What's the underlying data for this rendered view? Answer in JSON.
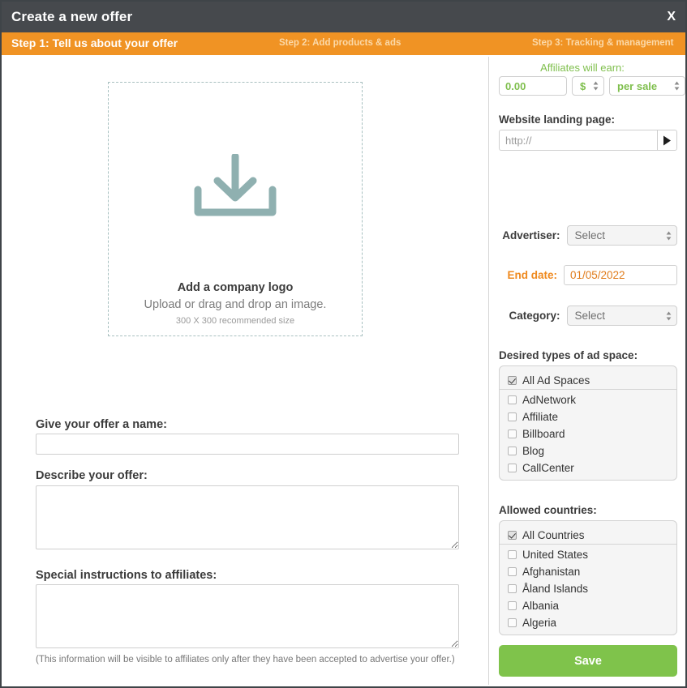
{
  "titlebar": {
    "title": "Create a new offer",
    "close_label": "X"
  },
  "steps": {
    "step1_prefix": "Step 1:",
    "step1": "Step 1: Tell us about your offer",
    "step2": "Step 2: Add products & ads",
    "step3": "Step 3: Tracking & management"
  },
  "left": {
    "dropzone": {
      "title": "Add a company logo",
      "subtitle": "Upload or drag and drop an image.",
      "hint": "300 X 300 recommended size",
      "icon": "download-arrow-icon"
    },
    "offer_name": {
      "label": "Give your offer a name:",
      "value": "",
      "placeholder": ""
    },
    "description": {
      "label": "Describe your offer:",
      "value": "",
      "placeholder": ""
    },
    "special_instructions": {
      "label": "Special instructions to affiliates:",
      "value": "",
      "placeholder": ""
    },
    "note": "(This information will be visible to affiliates only after they have been accepted to advertise your offer.)"
  },
  "right": {
    "earn": {
      "label": "Affiliates will earn:",
      "amount": "0.00",
      "currency": "$",
      "period": "per sale"
    },
    "landing": {
      "label": "Website landing page:",
      "value": "",
      "placeholder": "http://",
      "go_icon": "play-triangle-icon"
    },
    "advertiser": {
      "label": "Advertiser:",
      "value": "Select"
    },
    "end_date": {
      "label": "End date:",
      "value": "01/05/2022"
    },
    "category": {
      "label": "Category:",
      "value": "Select"
    },
    "ad_space": {
      "label": "Desired types of ad space:",
      "items": [
        {
          "label": "All Ad Spaces",
          "checked": true
        },
        {
          "label": "AdNetwork",
          "checked": false
        },
        {
          "label": "Affiliate",
          "checked": false
        },
        {
          "label": "Billboard",
          "checked": false
        },
        {
          "label": "Blog",
          "checked": false
        },
        {
          "label": "CallCenter",
          "checked": false
        }
      ]
    },
    "countries": {
      "label": "Allowed countries:",
      "items": [
        {
          "label": "All Countries",
          "checked": true
        },
        {
          "label": "United States",
          "checked": false
        },
        {
          "label": "Afghanistan",
          "checked": false
        },
        {
          "label": "Åland Islands",
          "checked": false
        },
        {
          "label": "Albania",
          "checked": false
        },
        {
          "label": "Algeria",
          "checked": false
        }
      ]
    },
    "save_label": "Save"
  },
  "colors": {
    "titlebar": "#46494d",
    "accent_orange": "#f09324",
    "accent_green": "#7fbf4d",
    "save_green": "#7fc34b",
    "dropzone_icon": "#8fb0b0"
  }
}
